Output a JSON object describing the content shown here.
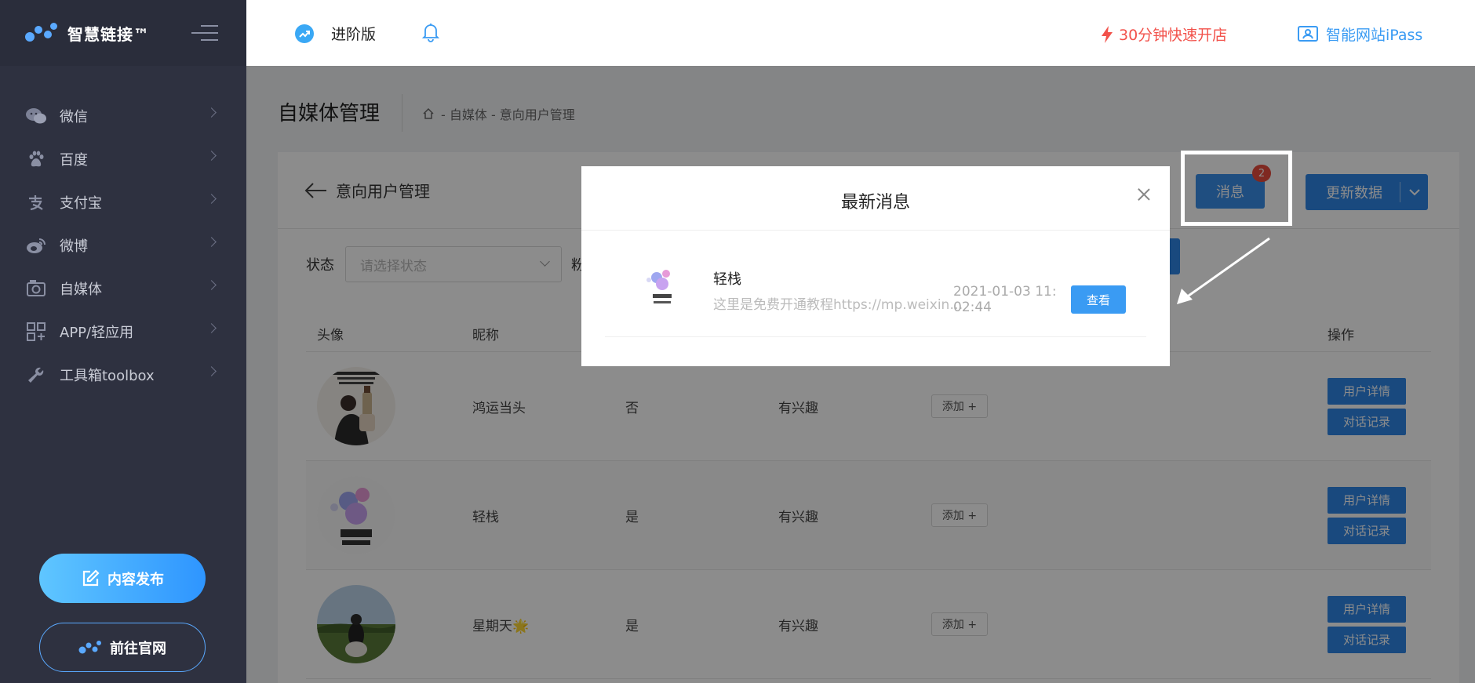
{
  "brand": {
    "name": "智慧链接™"
  },
  "sidebar": {
    "items": [
      {
        "label": "微信",
        "icon": "wechat-icon"
      },
      {
        "label": "百度",
        "icon": "baidu-paw-icon"
      },
      {
        "label": "支付宝",
        "icon": "alipay-icon"
      },
      {
        "label": "微博",
        "icon": "weibo-icon"
      },
      {
        "label": "自媒体",
        "icon": "media-icon"
      },
      {
        "label": "APP/轻应用",
        "icon": "app-grid-icon"
      },
      {
        "label": "工具箱toolbox",
        "icon": "wrench-icon"
      }
    ],
    "publish_label": "内容发布",
    "official_label": "前往官网"
  },
  "header": {
    "edition": "进阶版",
    "quick_store": "30分钟快速开店",
    "ipass": "智能网站iPass"
  },
  "page": {
    "title": "自媒体管理",
    "breadcrumb": "- 自媒体 - 意向用户管理",
    "section_title": "意向用户管理",
    "messages_label": "消息",
    "messages_count": "2",
    "update_label": "更新数据"
  },
  "filter": {
    "status_label": "状态",
    "status_placeholder": "请选择状态",
    "fans_label_partial": "粉"
  },
  "table": {
    "headers": {
      "avatar": "头像",
      "nickname": "昵称",
      "operations": "操作"
    },
    "add_label": "添加 +",
    "detail_label": "用户详情",
    "chat_label": "对话记录",
    "rows": [
      {
        "nickname": "鸿运当头",
        "subscribed": "否",
        "interest": "有兴趣"
      },
      {
        "nickname": "轻栈",
        "subscribed": "是",
        "interest": "有兴趣"
      },
      {
        "nickname": "星期天🌟",
        "subscribed": "是",
        "interest": "有兴趣"
      }
    ]
  },
  "modal": {
    "title": "最新消息",
    "item": {
      "name": "轻栈",
      "preview": "这里是免费开通教程https://mp.weixin.q...",
      "time": "2021-01-03 11:02:44",
      "view_label": "查看"
    }
  },
  "colors": {
    "sidebar_bg": "#2e3140",
    "primary": "#2f86e6",
    "accent_red": "#f2524b",
    "accent_blue": "#3a9bf3"
  }
}
